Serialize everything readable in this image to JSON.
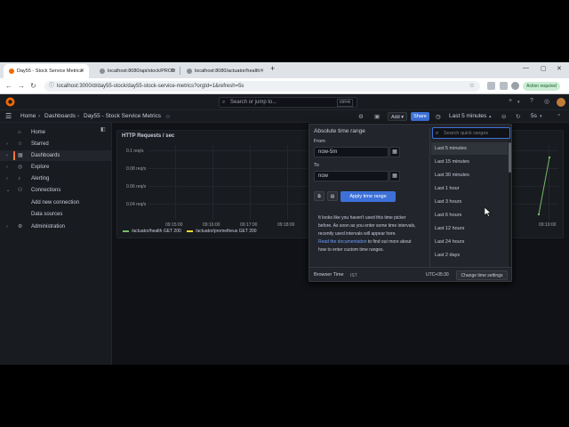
{
  "browser": {
    "tabs": [
      {
        "title": "Day55 - Stock Service Metrics",
        "active": true,
        "color": "#f46800"
      },
      {
        "title": "localhost:8080/api/stock/PROD",
        "active": false,
        "color": "#8a8f96"
      },
      {
        "title": "localhost:8080/actuator/health",
        "active": false,
        "color": "#8a8f96"
      }
    ],
    "new_tab": "+",
    "url": "localhost:3000/d/day55-stock/day55-stock-service-metrics?orgId=1&refresh=5s",
    "action_required": "Action required"
  },
  "topbar": {
    "search_placeholder": "Search or jump to...",
    "search_kbd": "ctrl+k",
    "plus": "+",
    "help": "?",
    "news": "◎",
    "avatar_color": "#c27c3a"
  },
  "breadcrumb": {
    "home": "Home",
    "dashboards": "Dashboards",
    "current": "Day55 - Stock Service Metrics"
  },
  "toolbar": {
    "add": "Add",
    "share": "Share",
    "time_range": "Last 5 minutes",
    "refresh": "5s"
  },
  "sidebar": {
    "items": [
      {
        "label": "Home",
        "icon": "⌂"
      },
      {
        "label": "Starred",
        "icon": "☆"
      },
      {
        "label": "Dashboards",
        "icon": "▦",
        "active": true
      },
      {
        "label": "Explore",
        "icon": "◎"
      },
      {
        "label": "Alerting",
        "icon": "♪"
      },
      {
        "label": "Connections",
        "icon": "⚇"
      },
      {
        "label": "Add new connection",
        "icon": ""
      },
      {
        "label": "Data sources",
        "icon": ""
      },
      {
        "label": "Administration",
        "icon": "⚙"
      }
    ]
  },
  "panel": {
    "title": "HTTP Requests / sec",
    "y_ticks": [
      "0.1 req/s",
      "0.08 req/s",
      "0.06 req/s",
      "0.04 req/s"
    ],
    "x_ticks": [
      "09:15:00",
      "09:16:00",
      "09:17:00",
      "09:18:00",
      "09:19:00"
    ],
    "legend": [
      {
        "name": "/actuator/health GET 200",
        "color": "#73bf69"
      },
      {
        "name": "/actuator/prometheus GET 200",
        "color": "#fade2a"
      }
    ]
  },
  "picker": {
    "title": "Absolute time range",
    "from_label": "From",
    "from_value": "now-5m",
    "to_label": "To",
    "to_value": "now",
    "apply": "Apply time range",
    "info_1": "It looks like you haven't used this time picker before. As soon as you enter some time intervals, recently used intervals will appear here.",
    "info_link": "Read the documentation",
    "info_2": " to find out more about how to enter custom time ranges.",
    "quick_search_placeholder": "Search quick ranges",
    "quick_ranges": [
      "Last 5 minutes",
      "Last 15 minutes",
      "Last 30 minutes",
      "Last 1 hour",
      "Last 3 hours",
      "Last 6 hours",
      "Last 12 hours",
      "Last 24 hours",
      "Last 2 days"
    ],
    "browser_time": "Browser Time",
    "tz_abbr": "IST",
    "utc_offset": "UTC+05:30",
    "change_settings": "Change time settings"
  }
}
